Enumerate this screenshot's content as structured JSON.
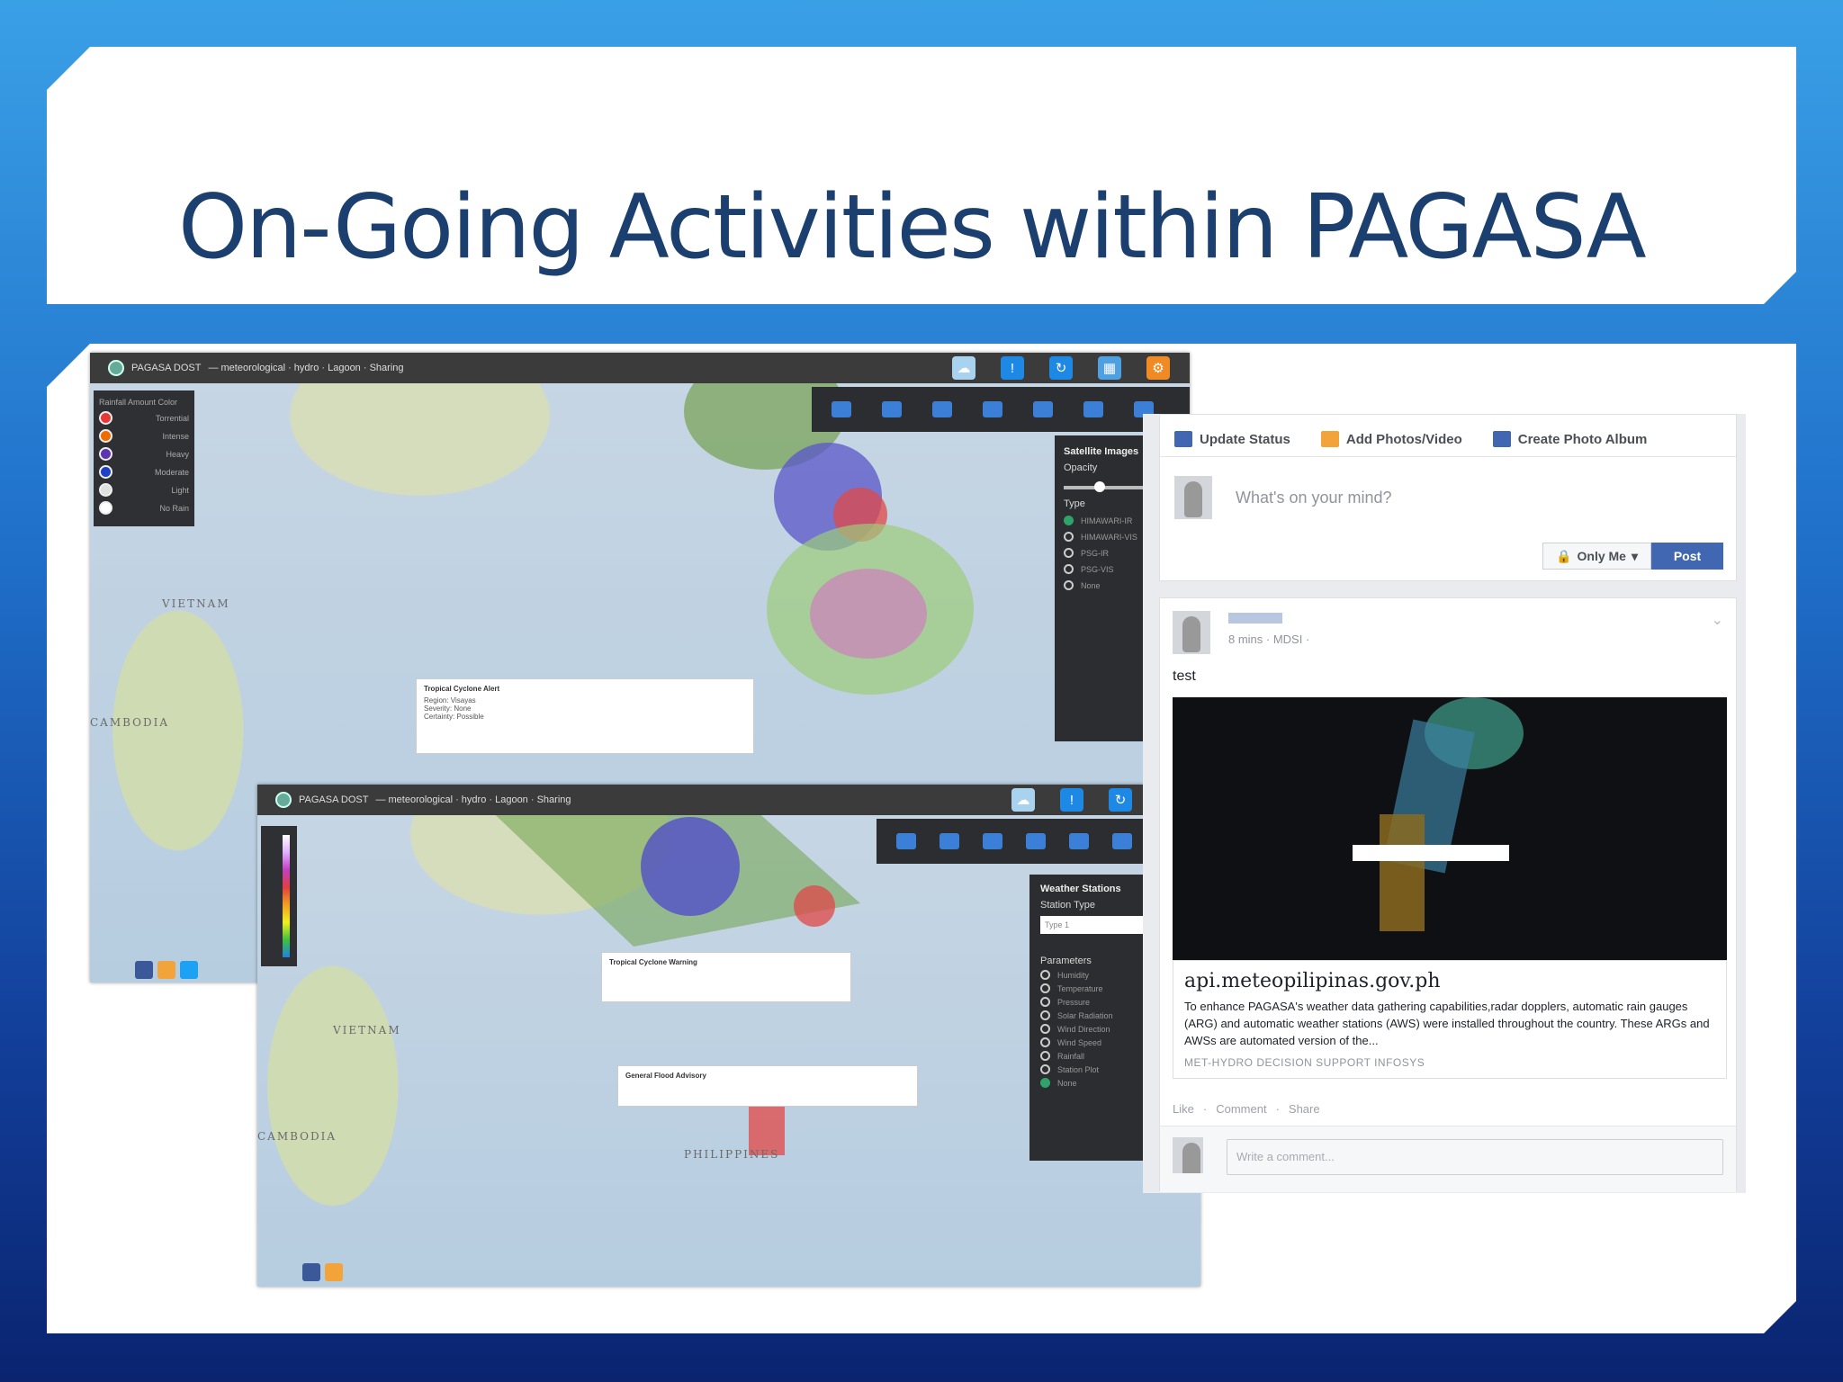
{
  "slide": {
    "title": "On-Going Activities within PAGASA"
  },
  "map1": {
    "brand": "PAGASA DOST",
    "nav": "— meteorological · hydro · Lagoon · Sharing",
    "legend_title": "Rainfall Amount Color",
    "legend": [
      {
        "label": "Torrential",
        "color": "#e53935"
      },
      {
        "label": "Intense",
        "color": "#ef6c00"
      },
      {
        "label": "Heavy",
        "color": "#5e35b1"
      },
      {
        "label": "Moderate",
        "color": "#1e40c8"
      },
      {
        "label": "Light",
        "color": "#e0e0e0"
      },
      {
        "label": "No Rain",
        "color": "#ffffff"
      }
    ],
    "panel_title": "Satellite Images",
    "opacity_label": "Opacity",
    "type_label": "Type",
    "types": [
      "HIMAWARI-IR",
      "HIMAWARI-VIS",
      "PSG-IR",
      "PSG-VIS",
      "None"
    ],
    "popup_title": "Tropical Cyclone Alert",
    "popup_lines": [
      "Region: Visayas",
      "Severity: None",
      "Certainty: Possible"
    ],
    "country_labels": [
      "VIETNAM",
      "CAMBODIA"
    ],
    "toolbar_colors": [
      "#a9d2ef",
      "#1e88e5",
      "#1e88e5",
      "#4ea0e0",
      "#f08a24"
    ]
  },
  "map2": {
    "brand": "PAGASA DOST",
    "nav": "— meteorological · hydro · Lagoon · Sharing",
    "panel_title": "Weather Stations",
    "station_type_label": "Station Type",
    "station_type_value": "Type 1",
    "params_label": "Parameters",
    "params": [
      "Humidity",
      "Temperature",
      "Pressure",
      "Solar Radiation",
      "Wind Direction",
      "Wind Speed",
      "Rainfall",
      "Station Plot",
      "None"
    ],
    "popup1_title": "Tropical Cyclone Warning",
    "popup2_title": "General Flood Advisory",
    "country_labels": [
      "VIETNAM",
      "CAMBODIA",
      "PHILIPPINES"
    ]
  },
  "facebook": {
    "tabs": [
      {
        "label": "Update Status",
        "color": "#4267b2"
      },
      {
        "label": "Add Photos/Video",
        "color": "#f2a33a"
      },
      {
        "label": "Create Photo Album",
        "color": "#4267b2"
      }
    ],
    "placeholder": "What's on your mind?",
    "privacy": "Only Me",
    "post_button": "Post",
    "post_meta": "8 mins · MDSI ·",
    "post_text": "test",
    "link_domain": "api.meteopilipinas.gov.ph",
    "link_description": "To enhance PAGASA's weather data gathering capabilities,radar dopplers, automatic rain gauges (ARG) and automatic weather stations (AWS) were installed throughout the country. These ARGs and AWSs are automated version of the...",
    "link_source": "MET-HYDRO DECISION SUPPORT INFOSYS",
    "actions": [
      "Like",
      "·",
      "Comment",
      "·",
      "Share"
    ],
    "comment_placeholder": "Write a comment..."
  }
}
